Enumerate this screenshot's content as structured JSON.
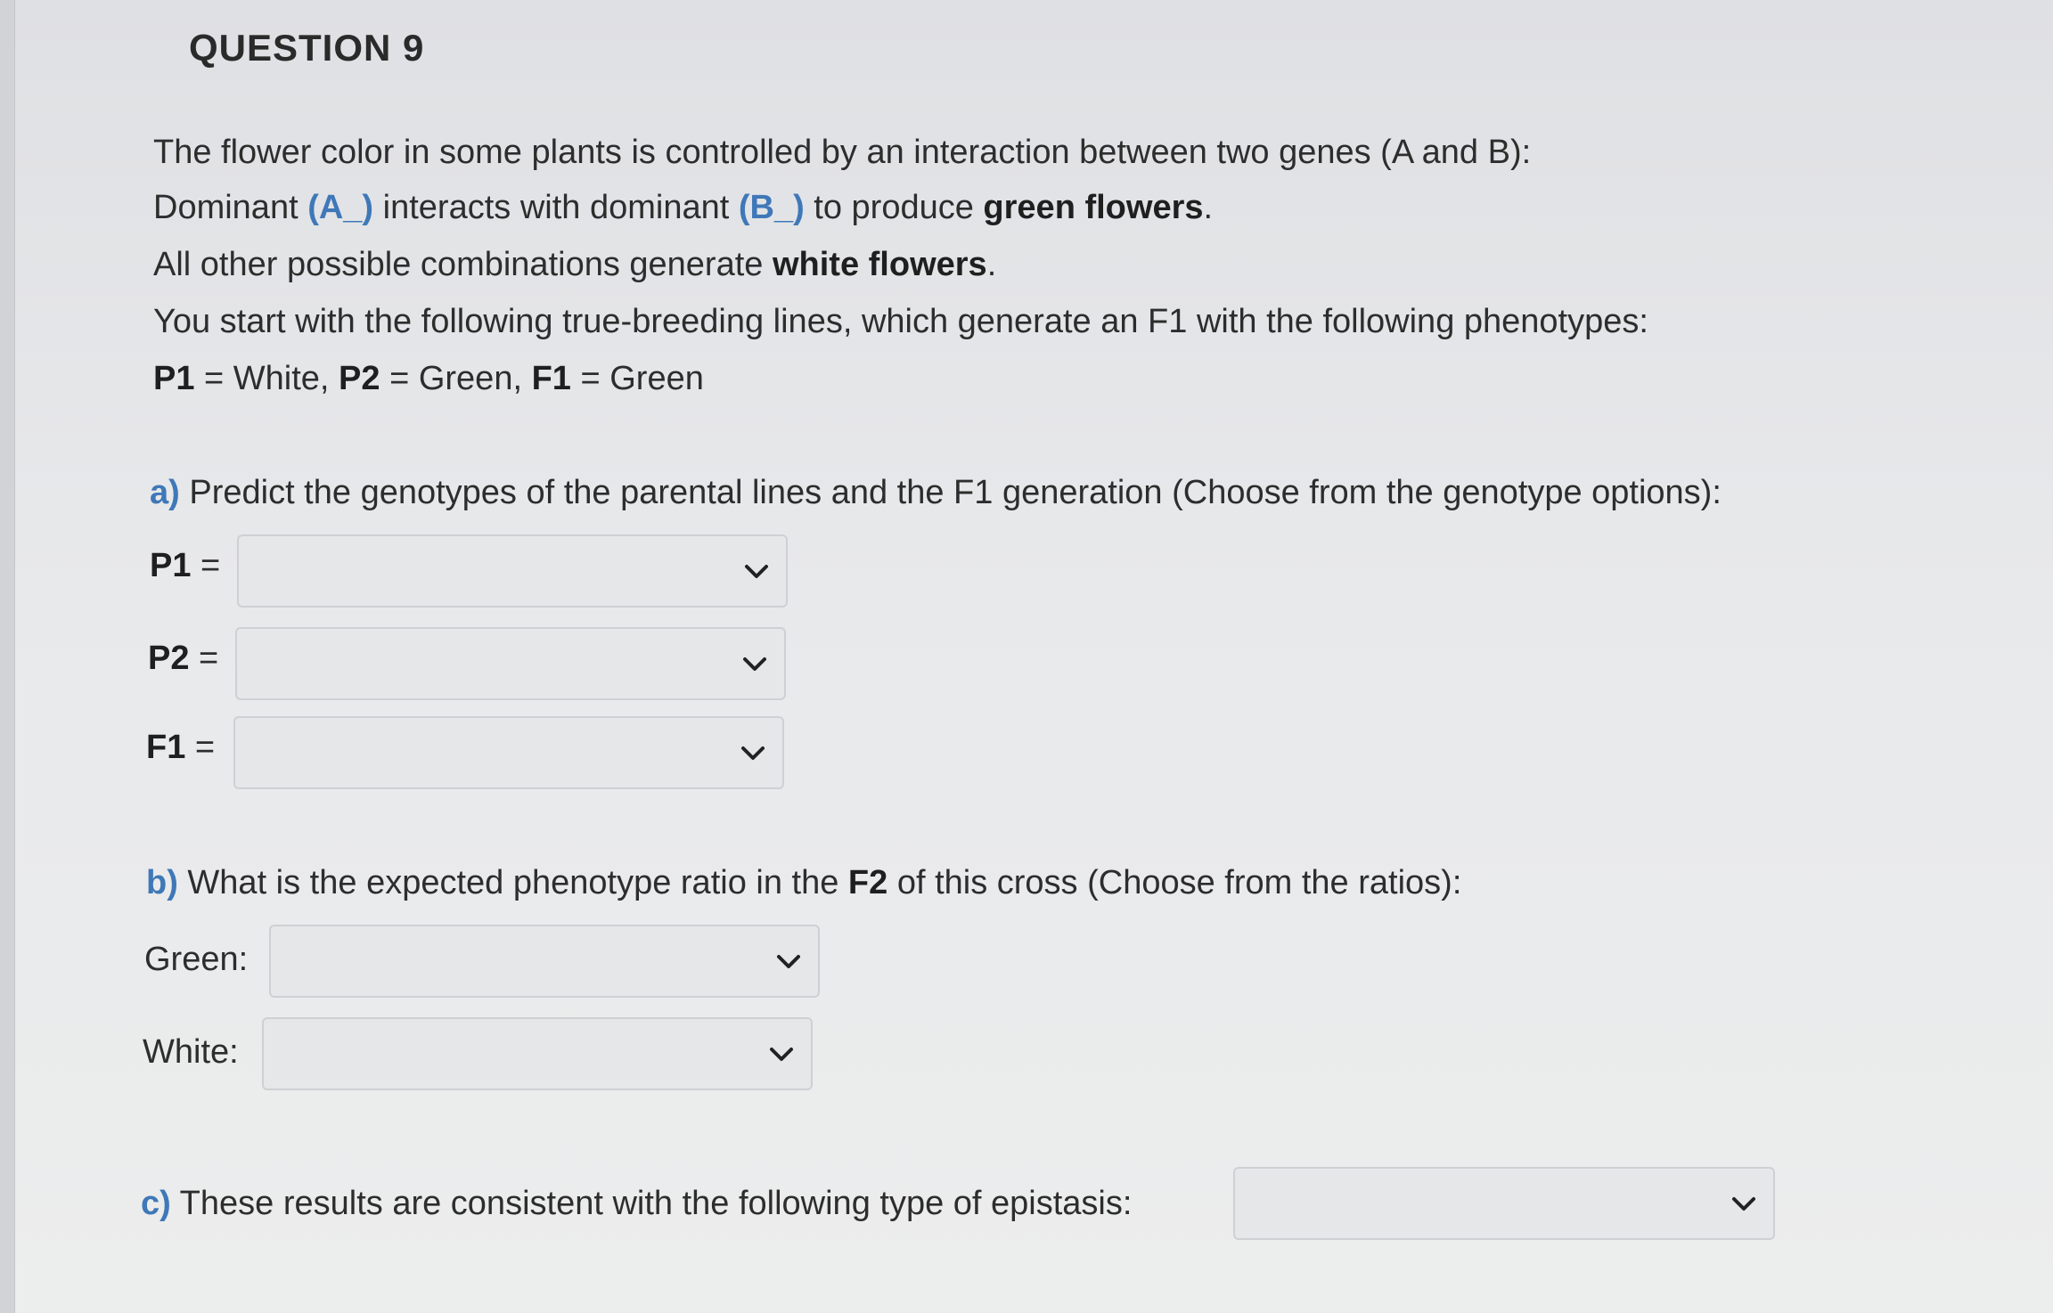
{
  "question": {
    "title": "QUESTION 9"
  },
  "intro": {
    "line1": "The flower color in some plants is controlled by an interaction between two genes (A and B):",
    "line2_pre": "Dominant ",
    "line2_a": "(A_)",
    "line2_mid": " interacts with dominant ",
    "line2_b": "(B_)",
    "line2_post1": " to produce ",
    "line2_bold": "green flowers",
    "line2_end": ".",
    "line3_pre": "All other possible combinations generate ",
    "line3_bold": "white flowers",
    "line3_end": ".",
    "line4": "You start with the following true-breeding lines, which generate an F1 with the following phenotypes:",
    "line5_p1": "P1",
    "line5_p1_val": " = White, ",
    "line5_p2": "P2",
    "line5_p2_val": " = Green, ",
    "line5_f1": "F1",
    "line5_f1_val": " = Green"
  },
  "part_a": {
    "letter": "a)",
    "prompt": " Predict the genotypes of the parental lines and the F1 generation (Choose from the genotype options):",
    "p1_label": "P1",
    "p2_label": "P2",
    "f1_label": "F1",
    "eq": " =",
    "p1_value": "",
    "p2_value": "",
    "f1_value": ""
  },
  "part_b": {
    "letter": "b)",
    "prompt_pre": " What is the expected phenotype ratio in the ",
    "prompt_bold": "F2",
    "prompt_post": " of this cross (Choose from the ratios):",
    "green_label": "Green:",
    "white_label": "White:",
    "green_value": "",
    "white_value": ""
  },
  "part_c": {
    "letter": "c)",
    "prompt": " These results are consistent with the following type of epistasis:",
    "value": ""
  },
  "icons": {
    "dropdown": "chevron-down-icon"
  },
  "colors": {
    "accent": "#3f78b8"
  }
}
